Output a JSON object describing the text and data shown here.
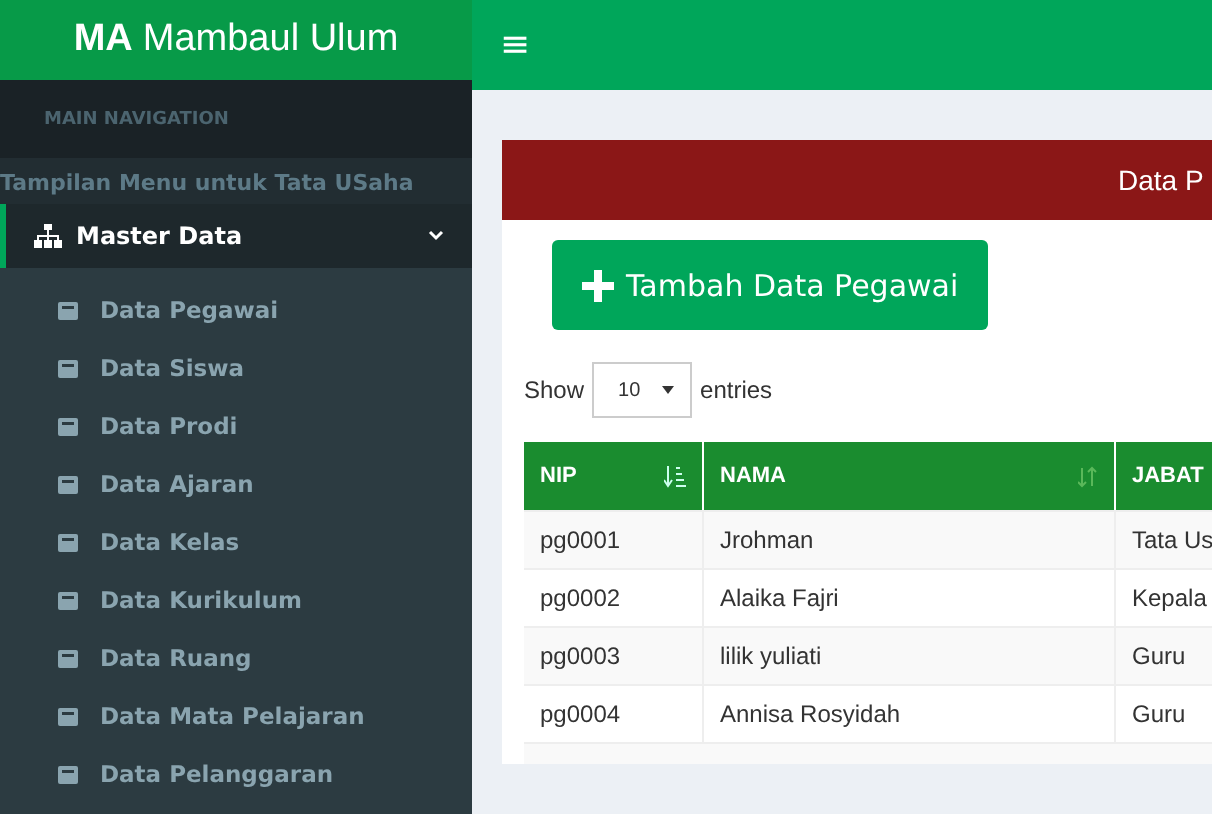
{
  "brand": {
    "bold": "MA",
    "rest": "Mambaul Ulum"
  },
  "sidebar": {
    "header": "MAIN NAVIGATION",
    "note": "Tampilan Menu untuk Tata USaha",
    "menu": {
      "label": "Master Data",
      "expanded": true,
      "children": [
        {
          "label": "Data Pegawai"
        },
        {
          "label": "Data Siswa"
        },
        {
          "label": "Data Prodi"
        },
        {
          "label": "Data Ajaran"
        },
        {
          "label": "Data Kelas"
        },
        {
          "label": "Data Kurikulum"
        },
        {
          "label": "Data Ruang"
        },
        {
          "label": "Data Mata Pelajaran"
        },
        {
          "label": "Data Pelanggaran"
        }
      ]
    }
  },
  "topbar": {
    "menu_glyph": "≡"
  },
  "box": {
    "title": "Data P",
    "add_button": "Tambah Data Pegawai",
    "length": {
      "show": "Show",
      "value": "10",
      "entries": "entries"
    },
    "table": {
      "columns": [
        "NIP",
        "NAMA",
        "JABAT"
      ],
      "rows": [
        [
          "pg0001",
          "Jrohman",
          "Tata Us"
        ],
        [
          "pg0002",
          "Alaika Fajri",
          "Kepala"
        ],
        [
          "pg0003",
          "lilik yuliati",
          "Guru"
        ],
        [
          "pg0004",
          "Annisa Rosyidah",
          "Guru"
        ]
      ]
    }
  }
}
